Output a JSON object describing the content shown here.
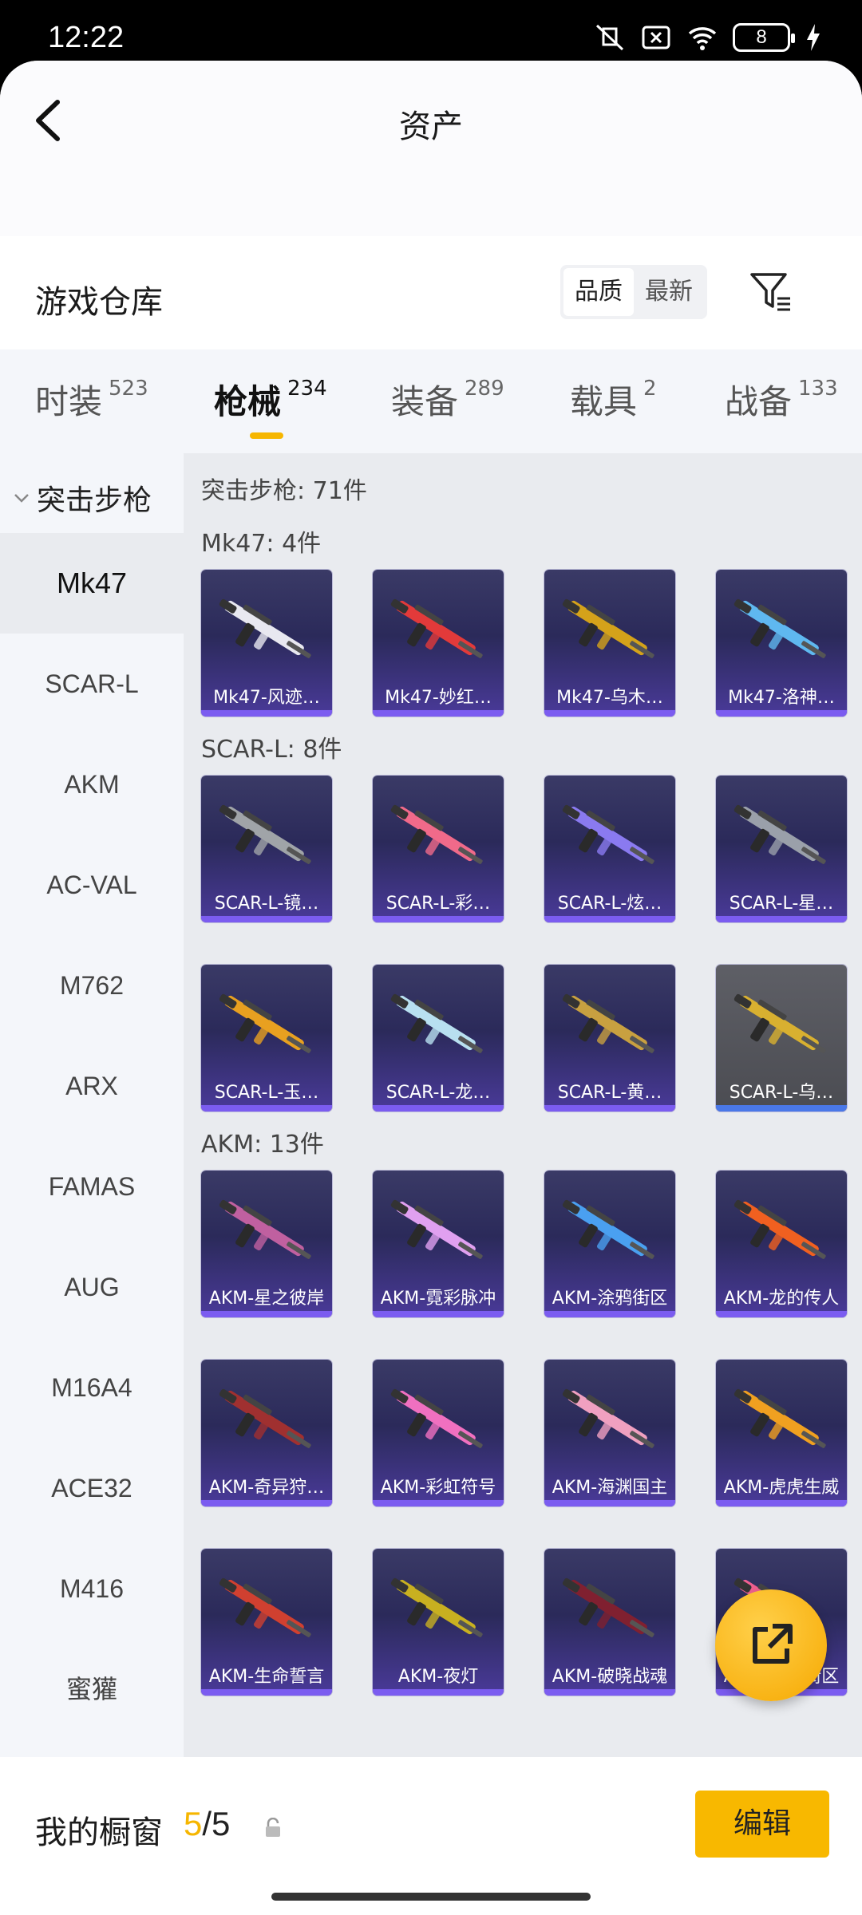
{
  "status_bar": {
    "time": "12:22",
    "battery": "8"
  },
  "header": {
    "title": "资产"
  },
  "warehouse": {
    "title": "游戏仓库",
    "sort_options": [
      "品质",
      "最新"
    ],
    "active_sort": "品质"
  },
  "tabs": [
    {
      "label": "时装",
      "count": "523"
    },
    {
      "label": "枪械",
      "count": "234"
    },
    {
      "label": "装备",
      "count": "289"
    },
    {
      "label": "载具",
      "count": "2"
    },
    {
      "label": "战备",
      "count": "133"
    }
  ],
  "active_tab": "枪械",
  "sidebar": {
    "group": "突击步枪",
    "items": [
      "Mk47",
      "SCAR-L",
      "AKM",
      "AC-VAL",
      "M762",
      "ARX",
      "FAMAS",
      "AUG",
      "M16A4",
      "ACE32",
      "M416",
      "蜜獾"
    ],
    "active": "Mk47"
  },
  "content": {
    "category_summary": "突击步枪: 71件",
    "sections": [
      {
        "title": "Mk47: 4件",
        "items": [
          {
            "name": "Mk47-风迹…",
            "accent": "#e8e8f0"
          },
          {
            "name": "Mk47-妙红…",
            "accent": "#e23a3a"
          },
          {
            "name": "Mk47-乌木…",
            "accent": "#d4a21a"
          },
          {
            "name": "Mk47-洛神…",
            "accent": "#5fb8f0"
          }
        ]
      },
      {
        "title": "SCAR-L: 8件",
        "items": [
          {
            "name": "SCAR-L-镜…",
            "accent": "#a0a4a8"
          },
          {
            "name": "SCAR-L-彩…",
            "accent": "#f06a8a"
          },
          {
            "name": "SCAR-L-炫…",
            "accent": "#8a7af0"
          },
          {
            "name": "SCAR-L-星…",
            "accent": "#9aa0aa"
          },
          {
            "name": "SCAR-L-玉…",
            "accent": "#e8a020"
          },
          {
            "name": "SCAR-L-龙…",
            "accent": "#b8e0f0"
          },
          {
            "name": "SCAR-L-黄…",
            "accent": "#c8a040"
          },
          {
            "name": "SCAR-L-乌…",
            "accent": "#d8b030"
          }
        ]
      },
      {
        "title": "AKM: 13件",
        "items": [
          {
            "name": "AKM-星之彼岸",
            "accent": "#c060a0"
          },
          {
            "name": "AKM-霓彩脉冲",
            "accent": "#e0a0f0"
          },
          {
            "name": "AKM-涂鸦街区",
            "accent": "#4aa0f0"
          },
          {
            "name": "AKM-龙的传人",
            "accent": "#f06020"
          },
          {
            "name": "AKM-奇异狩…",
            "accent": "#a03030"
          },
          {
            "name": "AKM-彩虹符号",
            "accent": "#f070c0"
          },
          {
            "name": "AKM-海渊国主",
            "accent": "#f0a0c0"
          },
          {
            "name": "AKM-虎虎生威",
            "accent": "#f0a020"
          },
          {
            "name": "AKM-生命誓言",
            "accent": "#d04030"
          },
          {
            "name": "AKM-夜灯",
            "accent": "#c8b020"
          },
          {
            "name": "AKM-破晓战魂",
            "accent": "#802030"
          },
          {
            "name": "AKM-霓虹街区",
            "accent": "#f06090"
          }
        ]
      }
    ]
  },
  "footer": {
    "label": "我的橱窗",
    "current": "5",
    "total": "/5",
    "edit": "编辑"
  }
}
